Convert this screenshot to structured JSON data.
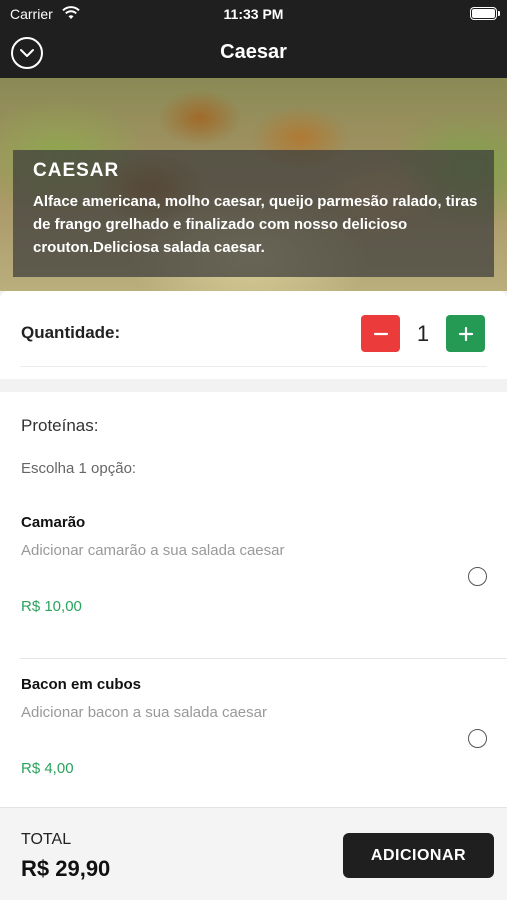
{
  "status_bar": {
    "carrier": "Carrier",
    "time": "11:33 PM",
    "wifi_icon": "wifi-icon",
    "battery_icon": "battery-icon"
  },
  "nav": {
    "title": "Caesar",
    "back_icon": "chevron-down-circle-icon"
  },
  "dish": {
    "name": "CAESAR",
    "description": "Alface americana, molho caesar, queijo parmesão ralado, tiras de frango grelhado e finalizado com nosso delicioso crouton.Deliciosa salada caesar."
  },
  "quantity": {
    "label": "Quantidade:",
    "value": "1",
    "minus_icon": "minus-icon",
    "plus_icon": "plus-icon"
  },
  "options": {
    "title": "Proteínas:",
    "subtitle": "Escolha 1 opção:",
    "items": [
      {
        "name": "Camarão",
        "description": "Adicionar camarão a sua salada caesar",
        "price": "R$ 10,00",
        "selected": false
      },
      {
        "name": "Bacon em cubos",
        "description": "Adicionar bacon a sua salada caesar",
        "price": "R$ 4,00",
        "selected": false
      }
    ]
  },
  "footer": {
    "total_label": "TOTAL",
    "total_value": "R$ 29,90",
    "add_label": "ADICIONAR"
  },
  "colors": {
    "header_bg": "#1f1f1f",
    "minus_red": "#eb3b3b",
    "plus_green": "#259a55",
    "price_green": "#2aa35e"
  }
}
